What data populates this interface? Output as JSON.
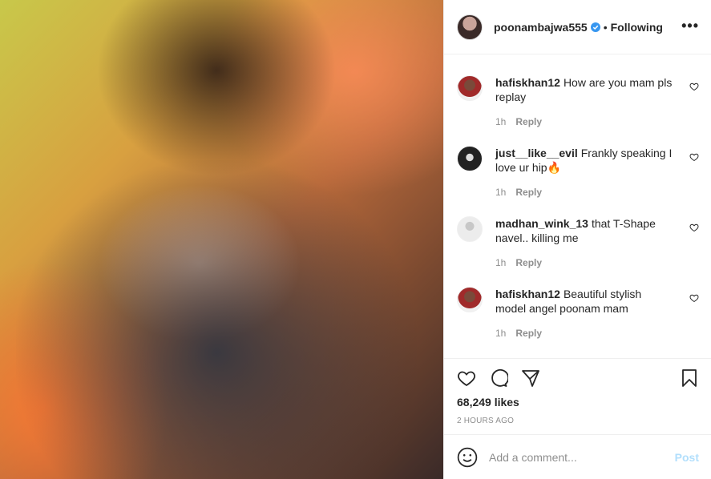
{
  "post": {
    "username": "poonambajwa555",
    "separator": "•",
    "follow_status": "Following",
    "more_icon": "more-horizontal-icon",
    "verified_color": "#3897f0"
  },
  "comments": [
    {
      "username": "hafiskhan12",
      "text": "How are you mam pls replay",
      "time": "1h",
      "reply": "Reply"
    },
    {
      "username": "just__like__evil",
      "text": "Frankly speaking I love ur hip🔥",
      "time": "1h",
      "reply": "Reply"
    },
    {
      "username": "madhan_wink_13",
      "text": "that T-Shape navel.. killing me",
      "time": "1h",
      "reply": "Reply"
    },
    {
      "username": "hafiskhan12",
      "text": "Beautiful stylish model angel poonam mam",
      "time": "1h",
      "reply": "Reply"
    }
  ],
  "actions": {
    "likes": "68,249 likes",
    "posted": "2 HOURS AGO"
  },
  "add_comment": {
    "placeholder": "Add a comment...",
    "post_label": "Post"
  }
}
